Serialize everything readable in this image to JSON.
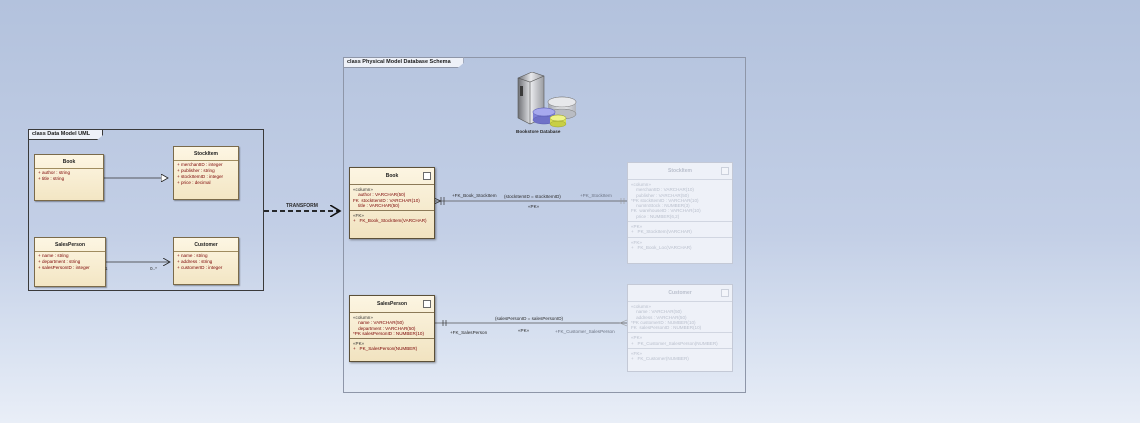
{
  "frames": {
    "uml": "class Data Model UML",
    "physical": "class Physical Model Database Schema"
  },
  "uml": {
    "book": {
      "title": "Book",
      "attrs": [
        "+ author : string",
        "+ title : string"
      ]
    },
    "stockitem": {
      "title": "StockItem",
      "attrs": [
        "+ merchantID : integer",
        "+ publisher : string",
        "+ stockItemID : integer",
        "+ price : decimal"
      ]
    },
    "salesperson": {
      "title": "SalesPerson",
      "attrs": [
        "+ name : string",
        "+ department : string",
        "+ salesPersonID : integer"
      ]
    },
    "customer": {
      "title": "Customer",
      "attrs": [
        "+ name : string",
        "+ address : string",
        "+ customerID : integer"
      ]
    },
    "multiplicity_one": "1",
    "multiplicity_many": "0..*"
  },
  "transform_label": "TRANSFORM",
  "database": {
    "label": "Bookstore Database",
    "icon": "database-server-icon"
  },
  "tables": {
    "book": {
      "title": "Book",
      "columns_stereo": "«column»",
      "columns": [
        "    author : VARCHAR(50)",
        "FK  stockItemID : VARCHAR(10)",
        "    title : VARCHAR(50)"
      ],
      "fk_stereo": "«FK»",
      "fks": [
        "+   FK_Book_StockItem(VARCHAR)"
      ]
    },
    "salesperson": {
      "title": "SalesPerson",
      "columns_stereo": "«column»",
      "columns": [
        "    name : VARCHAR(50)",
        "    department : VARCHAR(50)",
        "*PK salesPersonID : NUMBER(10)"
      ],
      "pk_stereo": "«PK»",
      "pks": [
        "+   PK_SalesPerson(NUMBER)"
      ]
    },
    "stockitem": {
      "title": "StockItem",
      "columns_stereo": "«column»",
      "columns": [
        "    merchantID : VARCHAR(10)",
        "    publisher : VARCHAR(50)",
        "*PK stockItemID : VARCHAR(10)",
        "    numInStock : NUMBER(3)",
        "FK  warehouseID : VARCHAR(10)",
        "    price : NUMBER(6,2)"
      ],
      "pk_stereo": "«PK»",
      "pks": [
        "+   PK_StockItem(VARCHAR)"
      ],
      "fk_stereo": "«FK»",
      "fks": [
        "+   FK_Book_Loc(VARCHAR)"
      ]
    },
    "customer": {
      "title": "Customer",
      "columns_stereo": "«column»",
      "columns": [
        "    name : VARCHAR(50)",
        "    address : VARCHAR(50)",
        "*PK customerID : NUMBER(10)",
        "FK  salesPersonID : NUMBER(10)"
      ],
      "pk_stereo": "«PK»",
      "pks": [
        "+   PK_Customer_SalesPerson(NUMBER)"
      ],
      "fk_stereo": "«FK»",
      "fks": [
        "+   FK_Customer(NUMBER)"
      ]
    }
  },
  "relations": {
    "book_stock": {
      "fk_label": "+FK_Book_StockItem",
      "condition": "(stockItemID = stockItemID)",
      "pk_label": "+PK_StockItem",
      "pk_mid": "«PK»"
    },
    "sales_customer": {
      "condition": "(salesPersonID = salesPersonID)",
      "fk_label": "+FK_SalesPerson",
      "pk_mid": "«PK»",
      "pk_label": "+FK_Customer_SalesPerson"
    }
  }
}
